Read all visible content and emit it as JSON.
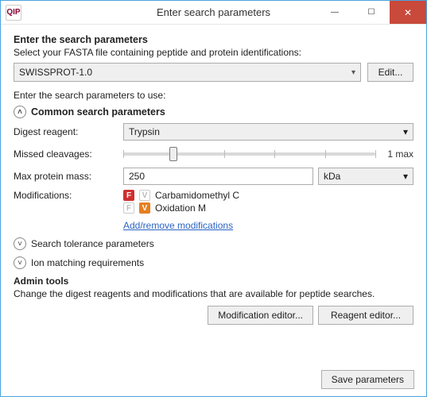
{
  "window": {
    "app_icon_text": "QIP",
    "title": "Enter search parameters",
    "buttons": {
      "min": "—",
      "max": "☐",
      "close": "✕"
    }
  },
  "header": {
    "title": "Enter the search parameters",
    "subtitle": "Select your FASTA file containing peptide and protein identifications:"
  },
  "fasta": {
    "selected": "SWISSPROT-1.0",
    "edit_label": "Edit..."
  },
  "params_intro": "Enter the search parameters to use:",
  "common": {
    "section_title": "Common search parameters",
    "digest_label": "Digest reagent:",
    "digest_value": "Trypsin",
    "missed_label": "Missed cleavages:",
    "missed_max_label": "1 max",
    "mass_label": "Max protein mass:",
    "mass_value": "250",
    "mass_unit": "kDa",
    "mods_label": "Modifications:",
    "mod1": {
      "tagF": "F",
      "tagV": "V",
      "text": "Carbamidomethyl C"
    },
    "mod2": {
      "tagF": "F",
      "tagV": "V",
      "text": "Oxidation M"
    },
    "add_remove": "Add/remove modifications"
  },
  "tolerance_section": "Search tolerance parameters",
  "ion_section": "Ion matching requirements",
  "admin": {
    "title": "Admin tools",
    "subtitle": "Change the digest reagents and modifications that are available for peptide searches.",
    "mod_editor": "Modification editor...",
    "reagent_editor": "Reagent editor..."
  },
  "footer": {
    "save": "Save parameters"
  }
}
